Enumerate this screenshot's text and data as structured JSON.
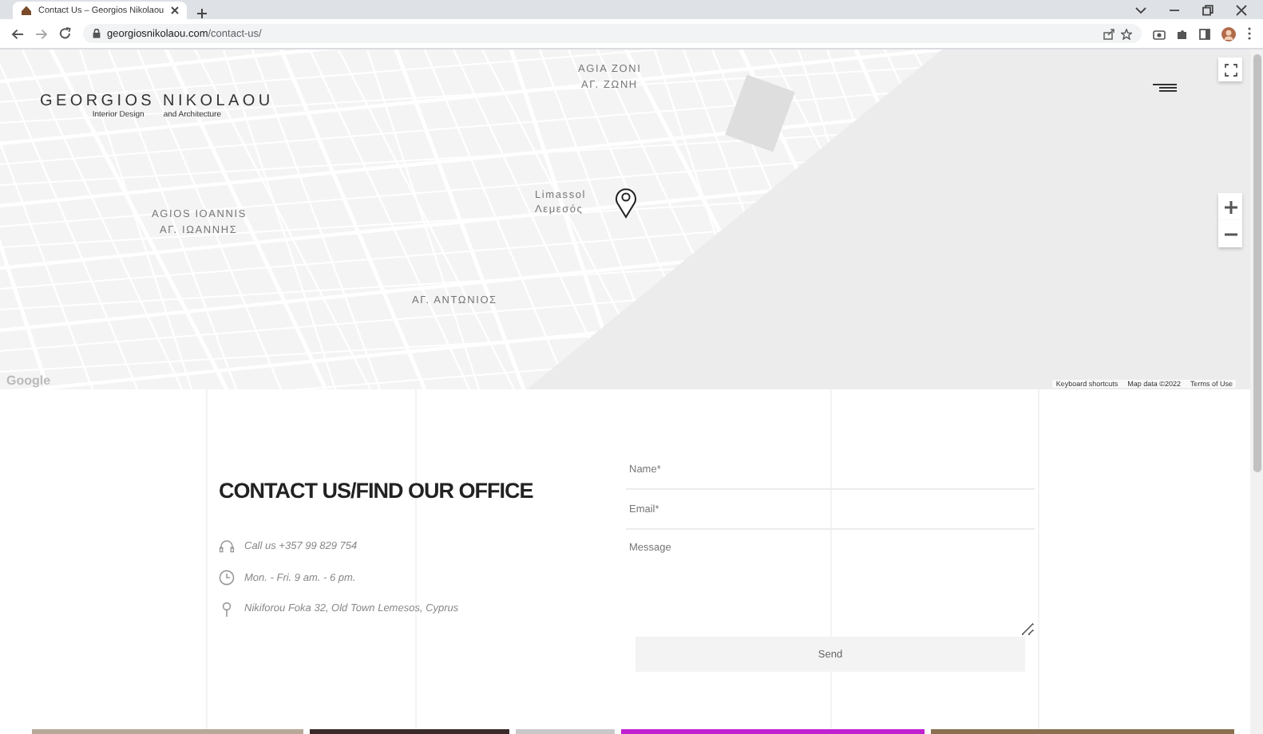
{
  "browser": {
    "tab_title": "Contact Us – Georgios Nikolaou",
    "url_host": "georgiosnikolaou.com",
    "url_path": "/contact-us/"
  },
  "map": {
    "logo_name": "GEORGIOS NIKOLAOU",
    "logo_tagline": [
      "Interior Design",
      "and Architecture"
    ],
    "labels": [
      {
        "text": "AGIA ZONI"
      },
      {
        "text": "ΑΓ. ΖΩΝΗ"
      },
      {
        "text": "AGIOS IOANNIS"
      },
      {
        "text": "ΑΓ. ΙΩΑΝΝΗΣ"
      },
      {
        "text": "Limassol"
      },
      {
        "text": "Λεμεσός"
      },
      {
        "text": "ΑΓ. ΑΝΤΩΝΙΟΣ"
      }
    ],
    "google_logo": "Google",
    "attribution": [
      "Keyboard shortcuts",
      "Map data ©2022",
      "Terms of Use"
    ]
  },
  "contact": {
    "title": "CONTACT US/FIND OUR OFFICE",
    "details": [
      {
        "kind": "phone",
        "text": "Call us +357 99 829 754"
      },
      {
        "kind": "hours",
        "text": "Mon. - Fri. 9 am. - 6 pm."
      },
      {
        "kind": "address",
        "text": "Nikiforou Foka 32, Old Town Lemesos, Cyprus"
      }
    ]
  },
  "form": {
    "fields": [
      {
        "kind": "input",
        "placeholder": "Name*"
      },
      {
        "kind": "input",
        "placeholder": "Email*"
      },
      {
        "kind": "textarea",
        "placeholder": "Message"
      }
    ],
    "submit": "Send"
  }
}
